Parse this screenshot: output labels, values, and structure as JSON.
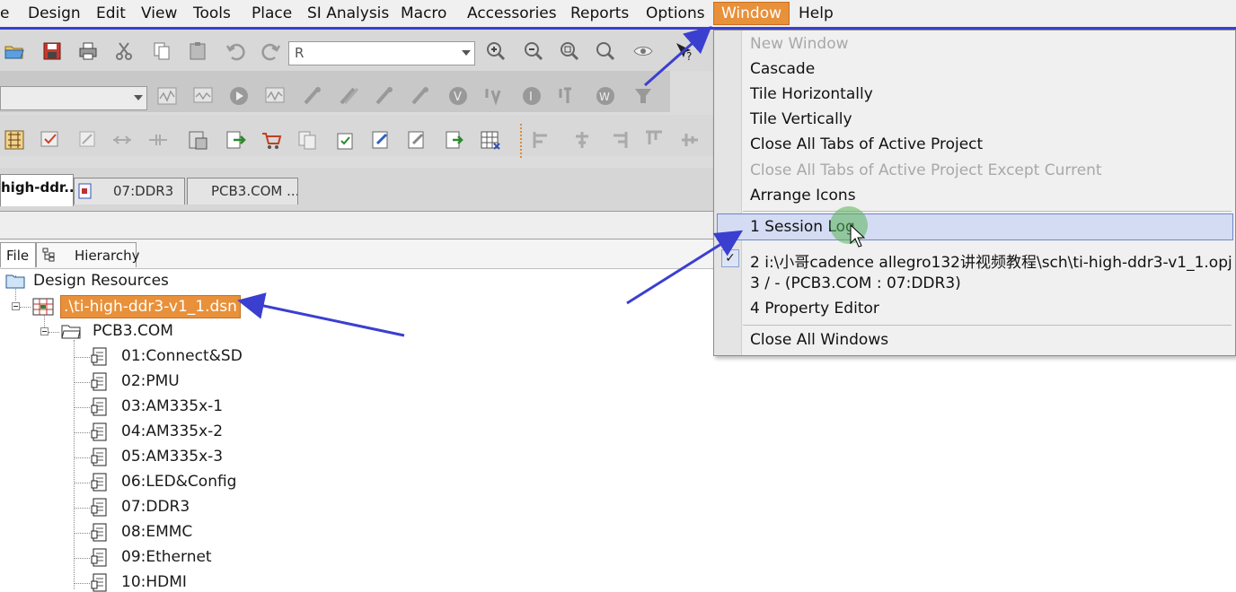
{
  "menubar": {
    "items": [
      "e",
      "Design",
      "Edit",
      "View",
      "Tools",
      "Place",
      "SI Analysis",
      "Macro",
      "Accessories",
      "Reports",
      "Options",
      "Window",
      "Help"
    ],
    "active": "Window"
  },
  "toolbar": {
    "search_value": "R"
  },
  "doc_tabs": [
    "high-ddr...",
    "07:DDR3",
    "PCB3.COM ..."
  ],
  "panel_tabs": [
    "File",
    "Hierarchy"
  ],
  "tree": {
    "root": "Design Resources",
    "dsn": ".\\ti-high-ddr3-v1_1.dsn",
    "folder": "PCB3.COM",
    "pages": [
      "01:Connect&SD",
      "02:PMU",
      "03:AM335x-1",
      "04:AM335x-2",
      "05:AM335x-3",
      "06:LED&Config",
      "07:DDR3",
      "08:EMMC",
      "09:Ethernet",
      "10:HDMI"
    ]
  },
  "window_menu": {
    "new_window": "New Window",
    "cascade": "Cascade",
    "tile_h": "Tile Horizontally",
    "tile_v": "Tile Vertically",
    "close_all_tabs": "Close All Tabs of Active Project",
    "close_all_except": "Close All Tabs of Active Project Except Current",
    "arrange": "Arrange Icons",
    "session_log": "1 Session Log",
    "recent2": "2 i:\\小哥cadence allegro132讲视频教程\\sch\\ti-high-ddr3-v1_1.opj",
    "recent3": "3 / - (PCB3.COM : 07:DDR3)",
    "recent4": "4 Property Editor",
    "close_all_windows": "Close All Windows"
  },
  "colors": {
    "highlight_orange": "#e8903a",
    "annotation_blue": "#3b3fd0",
    "menu_hover": "#d4dcf3"
  }
}
